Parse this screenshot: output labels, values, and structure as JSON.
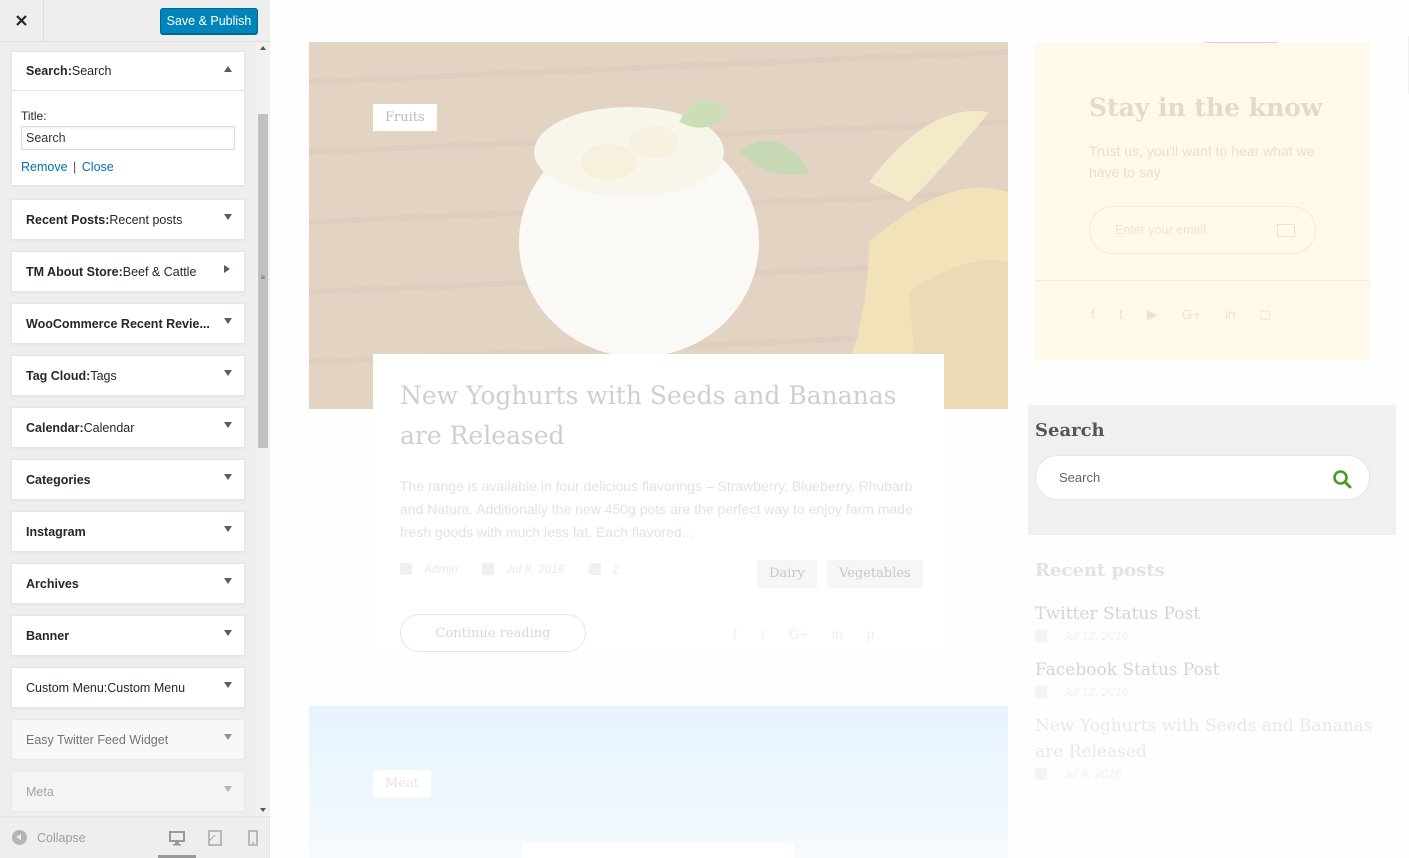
{
  "customizer": {
    "save_label": "Save & Publish",
    "widgets": [
      {
        "name": "Search:",
        "sub": " Search",
        "state": "expanded"
      },
      {
        "name": "Recent Posts:",
        "sub": " Recent posts",
        "state": "collapsed"
      },
      {
        "name": "TM About Store:",
        "sub": " Beef & Cattle",
        "state": "collapsed-right"
      },
      {
        "name": "WooCommerce Recent Revie...",
        "sub": "",
        "state": "collapsed"
      },
      {
        "name": "Tag Cloud:",
        "sub": " Tags",
        "state": "collapsed"
      },
      {
        "name": "Calendar:",
        "sub": " Calendar",
        "state": "collapsed"
      },
      {
        "name": "Categories",
        "sub": "",
        "state": "collapsed"
      },
      {
        "name": "Instagram",
        "sub": "",
        "state": "collapsed"
      },
      {
        "name": "Archives",
        "sub": "",
        "state": "collapsed"
      },
      {
        "name": "Banner",
        "sub": "",
        "state": "collapsed"
      },
      {
        "name": "Custom Menu:",
        "sub": " Custom Menu",
        "state": "collapsed"
      },
      {
        "name": "Easy Twitter Feed Widget",
        "sub": "",
        "state": "collapsed"
      },
      {
        "name": "Meta",
        "sub": "",
        "state": "collapsed"
      }
    ],
    "search_widget_form": {
      "title_label": "Title:",
      "title_value": "Search",
      "remove_label": "Remove",
      "separator": "|",
      "close_label": "Close"
    },
    "footer": {
      "collapse_label": "Collapse"
    }
  },
  "preview": {
    "post1": {
      "category": "Fruits",
      "title": "New Yoghurts with Seeds and Bananas are Released",
      "excerpt": "The range is available in four delicious flavorings – Strawberry, Blueberry, Rhubarb and Natura. Additionally the new 450g pots are the perfect way to enjoy farm made fresh goods with much less fat. Each flavored...",
      "author": "Admin",
      "date": "Jul 8, 2016",
      "comments": "2",
      "tags": [
        "Dairy",
        "Vegetables"
      ],
      "continue_label": "Continue reading",
      "share_icons": [
        "facebook-icon",
        "twitter-icon",
        "google-plus-icon",
        "linkedin-icon",
        "pinterest-icon"
      ]
    },
    "post2": {
      "category": "Meat"
    },
    "subscribe": {
      "title": "Stay in the know",
      "text": "Trust us, you'll want to hear what we have to say",
      "email_placeholder": "Enter your email",
      "social_icons": [
        "facebook-icon",
        "twitter-icon",
        "youtube-icon",
        "google-plus-icon",
        "linkedin-icon",
        "instagram-icon"
      ]
    },
    "search_widget": {
      "title": "Search",
      "placeholder": "Search"
    },
    "recent_posts": {
      "title": "Recent posts",
      "items": [
        {
          "title": "Twitter Status Post",
          "date": "Jul 12, 2016"
        },
        {
          "title": "Facebook Status Post",
          "date": "Jul 12, 2016"
        },
        {
          "title": "New Yoghurts with Seeds and Bananas are Released",
          "date": "Jul 8, 2016"
        }
      ]
    }
  },
  "colors": {
    "primary_button": "#0085ba",
    "link": "#0073aa",
    "search_icon": "#4a9a1e",
    "sticky_corner": "#f7c8c2",
    "subscribe_bg": "#fef9e8"
  }
}
